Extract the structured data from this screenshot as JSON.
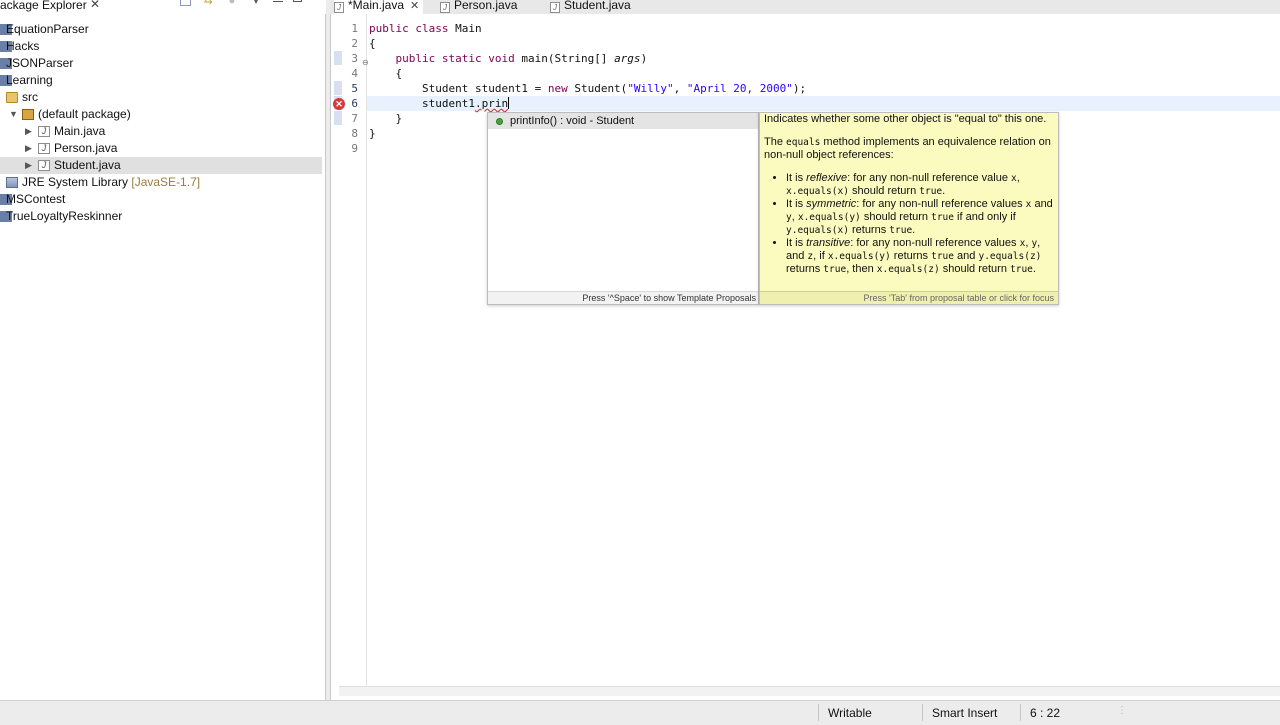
{
  "package_explorer": {
    "title": "ackage Explorer",
    "close_glyph": "✕",
    "items": [
      {
        "label": "EquationParser"
      },
      {
        "label": "Hacks"
      },
      {
        "label": "JSONParser"
      },
      {
        "label": "Learning"
      },
      {
        "label": "src"
      },
      {
        "label": "(default package)"
      },
      {
        "label": "Main.java"
      },
      {
        "label": "Person.java"
      },
      {
        "label": "Student.java"
      },
      {
        "label": "JRE System Library",
        "decoration": "[JavaSE-1.7]"
      },
      {
        "label": "MSContest"
      },
      {
        "label": "TrueLoyaltyReskinner"
      }
    ]
  },
  "editor_tabs": [
    {
      "label": "*Main.java",
      "close_glyph": "✕"
    },
    {
      "label": "Person.java"
    },
    {
      "label": "Student.java"
    }
  ],
  "editor": {
    "line_numbers": [
      "1",
      "2",
      "3",
      "4",
      "5",
      "6",
      "7",
      "8",
      "9"
    ],
    "error_glyph": "✕",
    "fold_glyph": "⊖",
    "code": {
      "l1_kw": "public class",
      "l1_rest": " Main",
      "l2": "{",
      "l3_kw": "public static void",
      "l3_rest": " main(String[] ",
      "l3_arg": "args",
      "l3_end": ")",
      "l4": "{",
      "l5_a": "Student student1 = ",
      "l5_kw": "new",
      "l5_b": " Student(",
      "l5_s1": "\"Willy\"",
      "l5_c": ", ",
      "l5_s2": "\"April 20, 2000\"",
      "l5_d": ");",
      "l6_a": "student1",
      "l6_b": ".prin",
      "l7": "}",
      "l8": "}"
    }
  },
  "content_assist": {
    "proposal": "printInfo() : void - Student",
    "footer": "Press '^Space' to show Template Proposals"
  },
  "javadoc": {
    "summary": "Indicates whether some other object is \"equal to\" this one.",
    "p2_a": "The ",
    "p2_code": "equals",
    "p2_b": " method implements an equivalence relation on non-null object references:",
    "b1_a": "It is ",
    "b1_em": "reflexive",
    "b1_b": ": for any non-null reference value ",
    "b1_c1": "x",
    "b1_c": ", ",
    "b1_c2": "x.equals(x)",
    "b1_d": " should return ",
    "b1_c3": "true",
    "b1_e": ".",
    "b2_a": "It is ",
    "b2_em": "symmetric",
    "b2_b": ": for any non-null reference values ",
    "b2_c1": "x",
    "b2_c": " and ",
    "b2_c2": "y",
    "b2_d": ", ",
    "b2_c3": "x.equals(y)",
    "b2_e": " should return ",
    "b2_c4": "true",
    "b2_f": " if and only if ",
    "b2_c5": "y.equals(x)",
    "b2_g": " returns ",
    "b2_c6": "true",
    "b2_h": ".",
    "b3_a": "It is ",
    "b3_em": "transitive",
    "b3_b": ": for any non-null reference values ",
    "b3_c1": "x",
    "b3_c": ", ",
    "b3_c2": "y",
    "b3_d": ", and ",
    "b3_c3": "z",
    "b3_e": ", if ",
    "b3_c4": "x.equals(y)",
    "b3_f": " returns ",
    "b3_c5": "true",
    "b3_g": " and ",
    "b3_c6": "y.equals(z)",
    "b3_h": " returns ",
    "b3_c7": "true",
    "b3_i": ", then ",
    "b3_c8": "x.equals(z)",
    "b3_j": " should return ",
    "b3_c9": "true",
    "b3_k": ".",
    "footer": "Press 'Tab' from proposal table or click for focus"
  },
  "status_bar": {
    "writable": "Writable",
    "insert_mode": "Smart Insert",
    "position": "6 : 22"
  }
}
